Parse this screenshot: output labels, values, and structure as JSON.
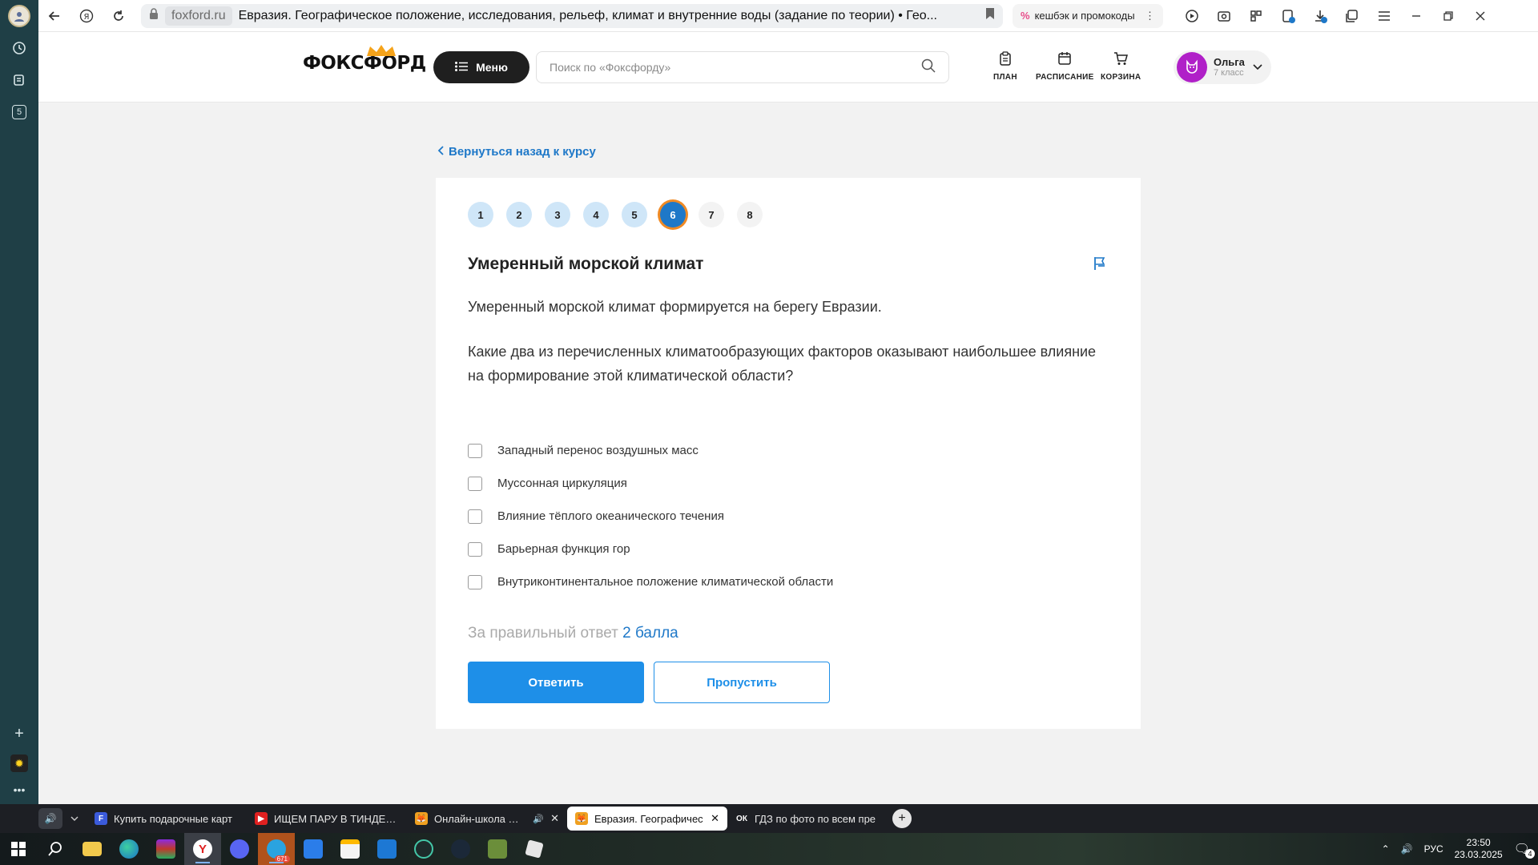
{
  "browser": {
    "host": "foxford.ru",
    "page_title": "Евразия. Географическое положение, исследования, рельеф, климат и внутренние воды (задание по теории) • Гео...",
    "cashback_label": "кешбэк и промокоды",
    "sidebar_badge": "5"
  },
  "site": {
    "logo": "ФОКСФОРД",
    "menu_label": "Меню",
    "search_placeholder": "Поиск по «Фоксфорду»",
    "nav": [
      {
        "label": "ПЛАН",
        "icon": "clipboard-icon"
      },
      {
        "label": "РАСПИСАНИЕ",
        "icon": "calendar-icon"
      },
      {
        "label": "КОРЗИНА",
        "icon": "cart-icon"
      }
    ],
    "user": {
      "name": "Ольга",
      "grade": "7 класс"
    }
  },
  "back_link": "Вернуться назад к курсу",
  "task": {
    "steps": [
      "1",
      "2",
      "3",
      "4",
      "5",
      "6",
      "7",
      "8"
    ],
    "completed_steps": 5,
    "current_step": "6",
    "title": "Умеренный морской климат",
    "paragraphs": [
      "Умеренный морской климат формируется на берегу Евразии.",
      "Какие два из перечисленных климатообразующих факторов оказывают наибольшее влияние на формирование этой климатической области?"
    ],
    "options": [
      "Западный перенос воздушных масс",
      "Муссонная циркуляция",
      "Влияние тёплого океанического течения",
      "Барьерная функция гор",
      "Внутриконтинентальное положение климатической области"
    ],
    "score_prefix": "За правильный ответ",
    "score_value": "2 балла",
    "answer_label": "Ответить",
    "skip_label": "Пропустить"
  },
  "tabs": [
    {
      "title": "Купить подарочные карт",
      "icon_text": "F",
      "color": "#3b5bdb"
    },
    {
      "title": "ИЩЕМ ПАРУ В ТИНДЕРЕ",
      "icon_text": "▶",
      "color": "#e02020"
    },
    {
      "title": "Онлайн-школа Фокс",
      "icon_text": "🦊",
      "color": "#f0a020"
    },
    {
      "title": "Евразия. Географичес",
      "icon_text": "🦊",
      "color": "#f0a020",
      "active": true
    },
    {
      "title": "ГДЗ по фото по всем пре",
      "icon_text": "ОК",
      "color": "#1d1f24"
    }
  ],
  "taskbar": {
    "telegram_badge": "671",
    "lang": "РУС",
    "time": "23:50",
    "date": "23.03.2025",
    "notif_count": "4"
  }
}
